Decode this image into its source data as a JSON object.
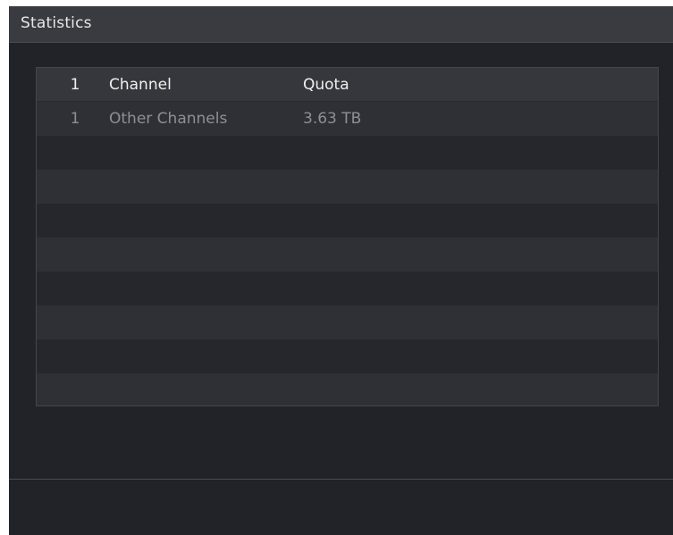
{
  "window": {
    "title": "Statistics"
  },
  "table": {
    "headers": [
      "1",
      "Channel",
      "Quota"
    ],
    "rows": [
      [
        "1",
        "Other Channels",
        "3.63 TB"
      ]
    ]
  },
  "colors": {
    "background": "#222328",
    "title_bar": "#3a3b40",
    "header_row": "#36373c",
    "row_light": "#2f3035",
    "row_dark": "#26272c",
    "text_primary": "#f0f0f0",
    "text_muted": "#8e8f94"
  }
}
